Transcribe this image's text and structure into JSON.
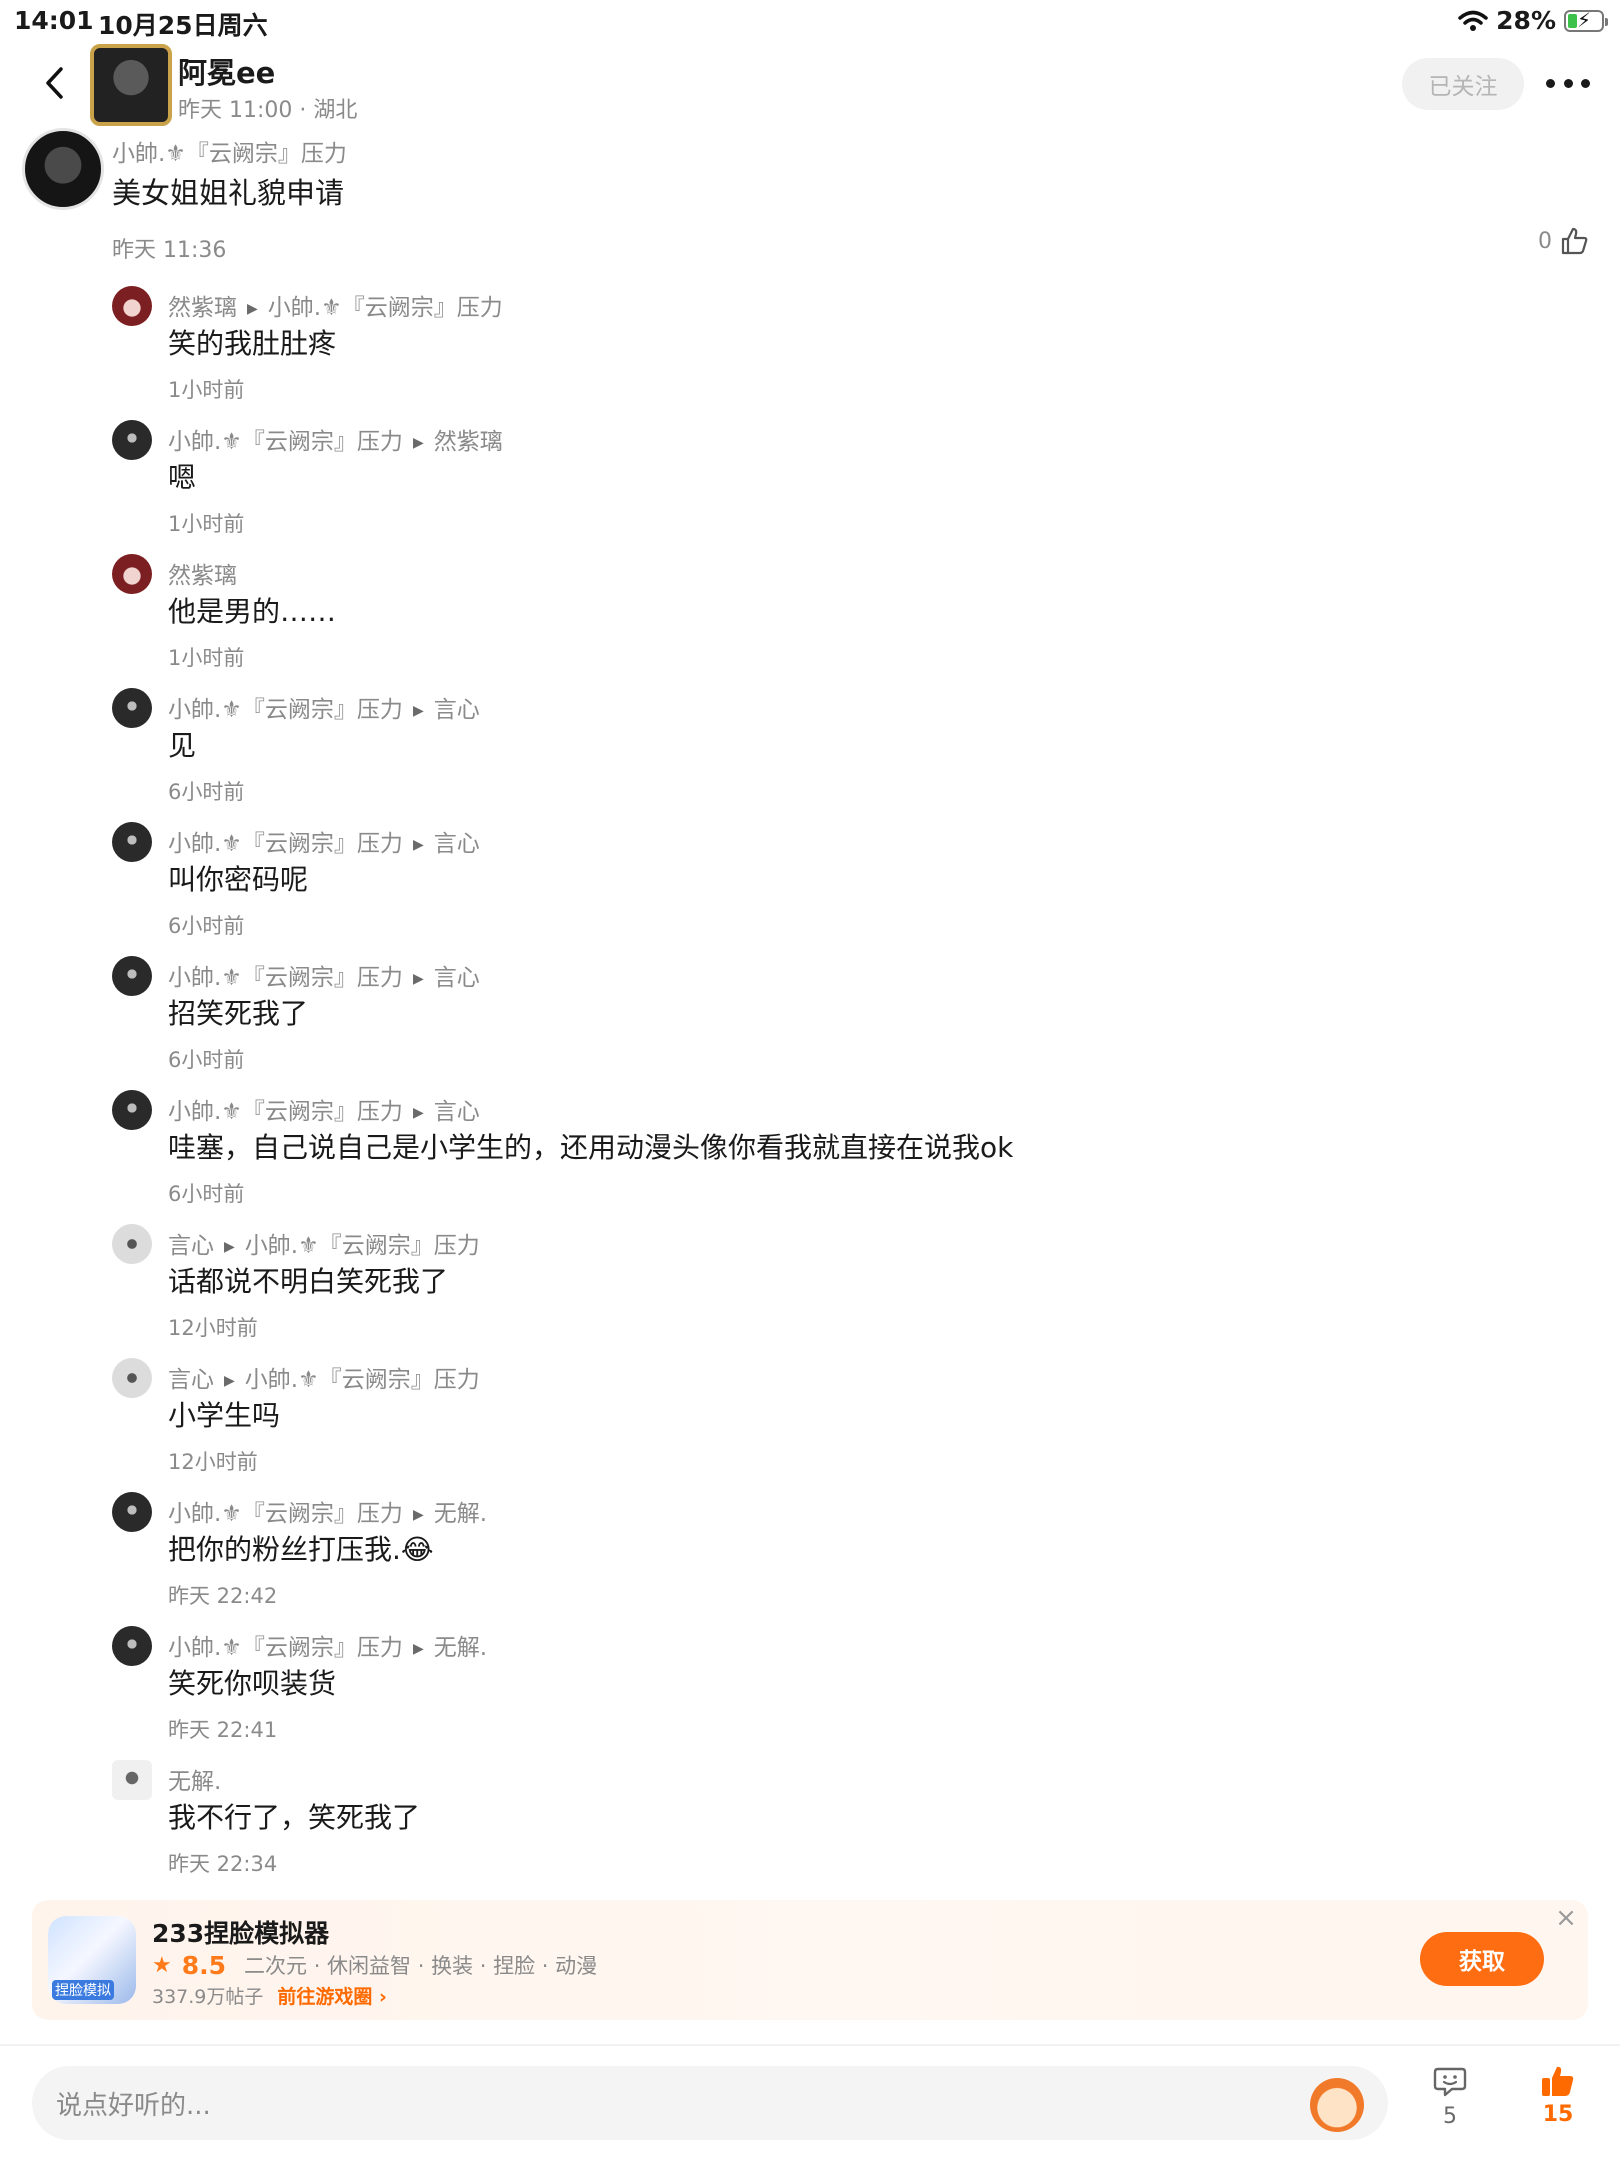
{
  "status_bar": {
    "time": "14:01",
    "date": "10月25日周六",
    "battery": "28%",
    "battery_level_percent": 28
  },
  "header": {
    "author_name": "阿冕ee",
    "post_meta": "昨天 11:00 · 湖北",
    "follow_label": "已关注"
  },
  "main_comment": {
    "author": "小帥.⚜『云阙宗』压力",
    "text": "美女姐姐礼貌申请",
    "time": "昨天 11:36",
    "likes": "0"
  },
  "replies": [
    {
      "from": "然紫璃",
      "to": "小帥.⚜『云阙宗』压力",
      "text": "笑的我肚肚疼",
      "time": "1小时前",
      "avatar": "red"
    },
    {
      "from": "小帥.⚜『云阙宗』压力",
      "to": "然紫璃",
      "text": "嗯",
      "time": "1小时前",
      "avatar": "dark"
    },
    {
      "from": "然紫璃",
      "to": "",
      "text": "他是男的……",
      "time": "1小时前",
      "avatar": "red"
    },
    {
      "from": "小帥.⚜『云阙宗』压力",
      "to": "言心",
      "text": "见",
      "time": "6小时前",
      "avatar": "dark"
    },
    {
      "from": "小帥.⚜『云阙宗』压力",
      "to": "言心",
      "text": "叫你密码呢",
      "time": "6小时前",
      "avatar": "dark"
    },
    {
      "from": "小帥.⚜『云阙宗』压力",
      "to": "言心",
      "text": "招笑死我了",
      "time": "6小时前",
      "avatar": "dark"
    },
    {
      "from": "小帥.⚜『云阙宗』压力",
      "to": "言心",
      "text": "哇塞，自己说自己是小学生的，还用动漫头像你看我就直接在说我ok",
      "time": "6小时前",
      "avatar": "dark"
    },
    {
      "from": "言心",
      "to": "小帥.⚜『云阙宗』压力",
      "text": "话都说不明白笑死我了",
      "time": "12小时前",
      "avatar": "light"
    },
    {
      "from": "言心",
      "to": "小帥.⚜『云阙宗』压力",
      "text": "小学生吗",
      "time": "12小时前",
      "avatar": "light"
    },
    {
      "from": "小帥.⚜『云阙宗』压力",
      "to": "无解.",
      "text": "把你的粉丝打压我.😂",
      "time": "昨天 22:42",
      "avatar": "dark"
    },
    {
      "from": "小帥.⚜『云阙宗』压力",
      "to": "无解.",
      "text": "笑死你呗装货",
      "time": "昨天 22:41",
      "avatar": "dark"
    },
    {
      "from": "无解.",
      "to": "",
      "text": "我不行了，笑死我了",
      "time": "昨天 22:34",
      "avatar": "sketch"
    }
  ],
  "ad": {
    "title": "233捏脸模拟器",
    "icon_text": "捏脸模拟",
    "rating": "8.5",
    "tags": "二次元 · 休闲益智 · 换装 · 捏脸 · 动漫",
    "posts": "337.9万帖子",
    "link": "前往游戏圈",
    "get_label": "获取"
  },
  "bottom_bar": {
    "input_placeholder": "说点好听的...",
    "comment_count": "5",
    "like_count": "15"
  },
  "colors": {
    "accent": "#ff6d12",
    "secondary_text": "#8a8a8a",
    "primary_text": "#1a1a1a"
  }
}
